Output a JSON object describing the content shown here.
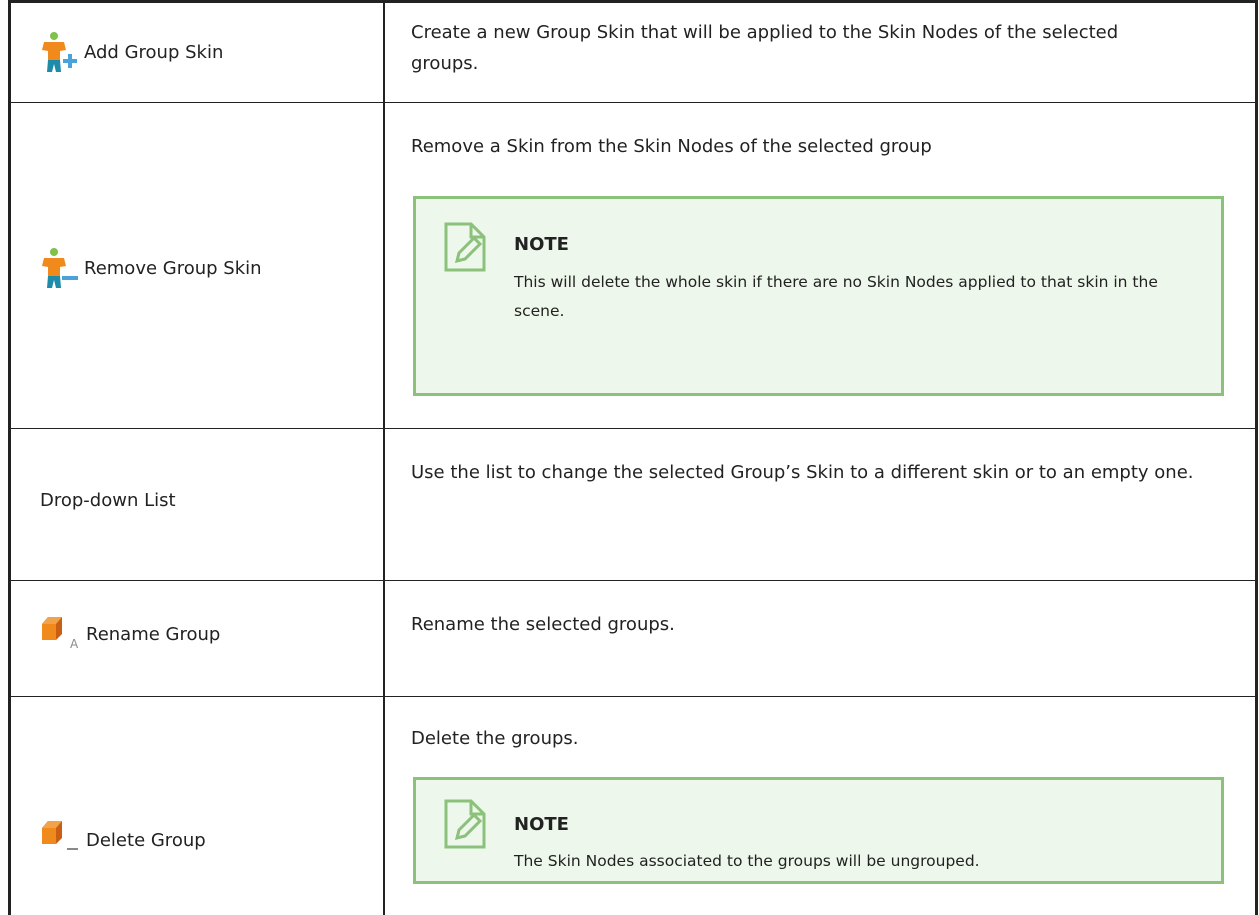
{
  "rows": [
    {
      "label": "Add Group Skin",
      "icon": "add-group-skin-icon",
      "description": "Create a new Group Skin that will be applied to the Skin Nodes of the selected groups."
    },
    {
      "label": "Remove Group Skin",
      "icon": "remove-group-skin-icon",
      "description": "Remove a Skin from the Skin Nodes of the selected group",
      "note": {
        "title": "NOTE",
        "text": "This will delete the whole skin if there are no Skin Nodes applied to that skin in the scene."
      }
    },
    {
      "label": "Drop-down List",
      "description": "Use the list to change the selected Group’s Skin to a different skin or to an empty one."
    },
    {
      "label": "Rename Group",
      "icon": "rename-group-icon",
      "description": "Rename the selected groups."
    },
    {
      "label": "Delete Group",
      "icon": "delete-group-icon",
      "description": "Delete the groups.",
      "note": {
        "title": "NOTE",
        "text": "The Skin Nodes associated to the groups will be ungrouped."
      }
    }
  ],
  "colors": {
    "note_bg": "#eef7eb",
    "note_border": "#8bc17a",
    "rule": "#222222"
  }
}
